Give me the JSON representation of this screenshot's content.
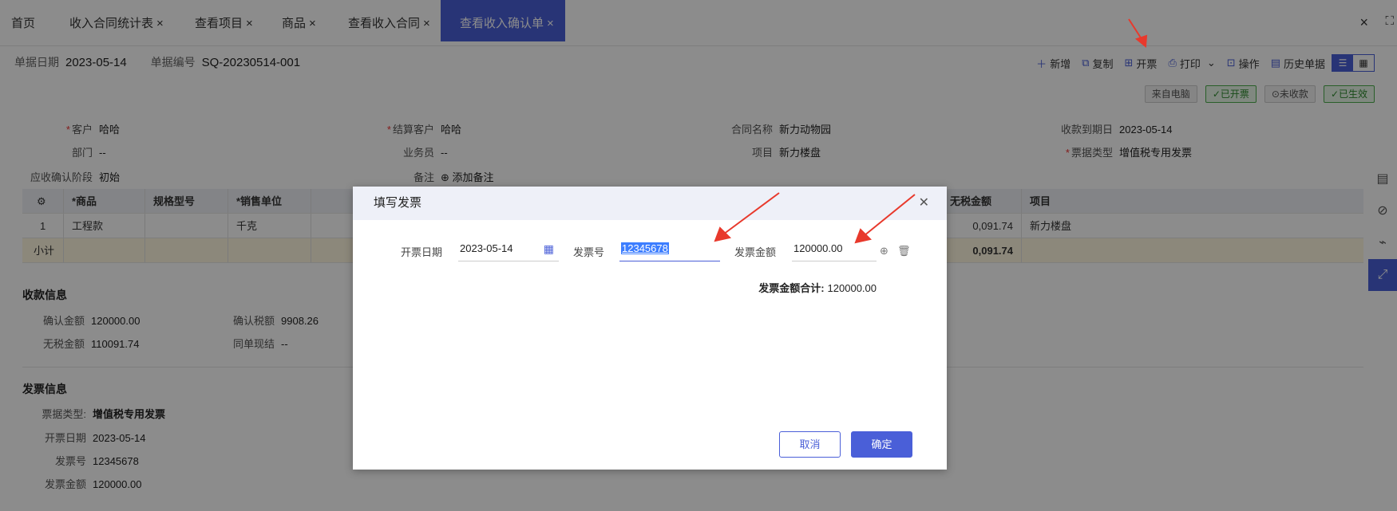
{
  "tabs": [
    {
      "label": "首页",
      "closable": false
    },
    {
      "label": "收入合同统计表",
      "closable": true
    },
    {
      "label": "查看项目",
      "closable": true
    },
    {
      "label": "商品",
      "closable": true
    },
    {
      "label": "查看收入合同",
      "closable": true
    },
    {
      "label": "查看收入确认单",
      "closable": true,
      "active": true
    }
  ],
  "window": {
    "close": "×",
    "maximize": "⛶"
  },
  "doc_meta": {
    "date_label": "单据日期",
    "date": "2023-05-14",
    "no_label": "单据编号",
    "no": "SQ-20230514-001"
  },
  "toolbar": {
    "add": "新增",
    "copy": "复制",
    "invoice": "开票",
    "print": "打印",
    "operate": "操作",
    "history": "历史单据"
  },
  "badges": [
    "来自电脑",
    "✓已开票",
    "⊙未收款",
    "✓已生效"
  ],
  "form": {
    "customer_label": "客户",
    "customer": "哈哈",
    "dept_label": "部门",
    "dept": "--",
    "stage_label": "应收确认阶段",
    "stage": "初始",
    "settle_label": "结算客户",
    "settle": "哈哈",
    "staff_label": "业务员",
    "staff": "--",
    "remark_label": "备注",
    "remark_add": "添加备注",
    "contract_label": "合同名称",
    "contract": "新力动物园",
    "project_label": "项目",
    "project": "新力楼盘",
    "due_label": "收款到期日",
    "due": "2023-05-14",
    "bill_type_label": "票据类型",
    "bill_type": "增值税专用发票"
  },
  "grid": {
    "headers": [
      "⚙",
      "*商品",
      "规格型号",
      "*销售单位",
      "",
      "无税金额",
      "项目"
    ],
    "row1": [
      "1",
      "工程款",
      "",
      "千克",
      "",
      "0,091.74",
      "新力楼盘"
    ],
    "subtotal": [
      "小计",
      "",
      "",
      "",
      "",
      "0,091.74",
      ""
    ]
  },
  "receipt": {
    "title": "收款信息",
    "confirm_label": "确认金额",
    "confirm": "120000.00",
    "tax_label": "确认税额",
    "tax": "9908.26",
    "notax_label": "无税金额",
    "notax": "110091.74",
    "cash_label": "同单现结",
    "cash": "--"
  },
  "invoice_info": {
    "title": "发票信息",
    "type_label": "票据类型:",
    "type": "增值税专用发票",
    "date_label": "开票日期",
    "date": "2023-05-14",
    "no_label": "发票号",
    "no": "12345678",
    "amount_label": "发票金额",
    "amount": "120000.00"
  },
  "dialog": {
    "title": "填写发票",
    "date_label": "开票日期",
    "date": "2023-05-14",
    "no_label": "发票号",
    "no": "12345678",
    "amount_label": "发票金额",
    "amount": "120000.00",
    "total_label": "发票金额合计:",
    "total": "120000.00",
    "cancel": "取消",
    "ok": "确定"
  },
  "colors": {
    "accent": "#4a5fd8",
    "arrow": "#e8392c"
  }
}
